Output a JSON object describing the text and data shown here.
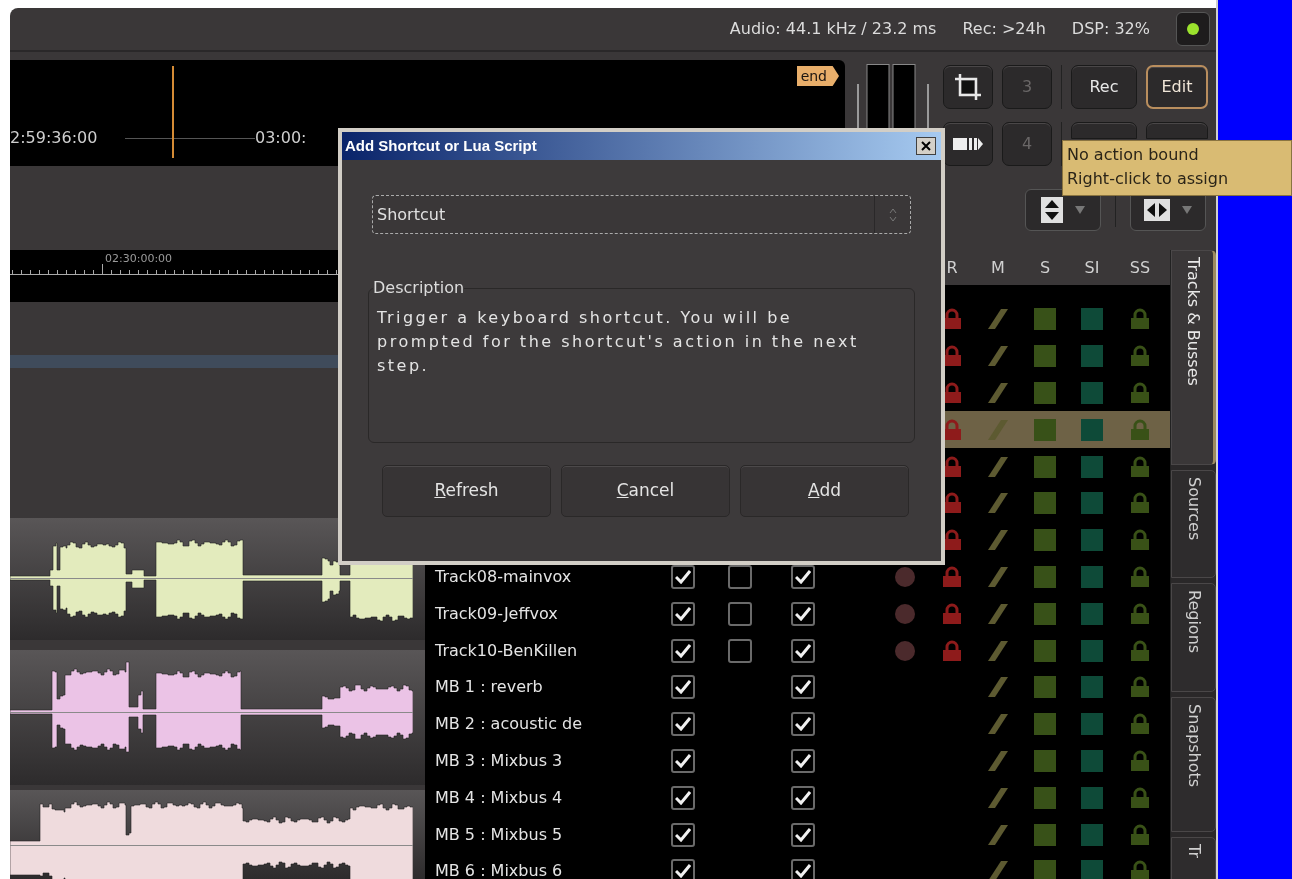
{
  "status_bar": {
    "items": [
      "Audio: 44.1 kHz / 23.2 ms",
      "Rec: >24h",
      "DSP: 32%"
    ],
    "indicator_on": true
  },
  "clock": {
    "timecodes": [
      "2:59:36:00",
      "03:00:"
    ],
    "end_marker": "end"
  },
  "number_buttons": [
    "3",
    "4"
  ],
  "mode_buttons": [
    {
      "label": "Rec",
      "selected": false
    },
    {
      "label": "Edit",
      "selected": true
    }
  ],
  "ruler": {
    "label": "02:30:00:00"
  },
  "regions": [
    {
      "color": "#e3ebbd"
    },
    {
      "color": "#ebc3e6"
    },
    {
      "color": "#efdbdd"
    }
  ],
  "tracks_list": {
    "columns": [
      "R",
      "M",
      "S",
      "SI",
      "SS"
    ],
    "rows": [
      {
        "kind": "track",
        "selected": false
      },
      {
        "kind": "track",
        "selected": false
      },
      {
        "kind": "track",
        "selected": false
      },
      {
        "kind": "track",
        "selected": true
      },
      {
        "kind": "track",
        "selected": false
      },
      {
        "kind": "track",
        "selected": false
      },
      {
        "kind": "track",
        "selected": false
      },
      {
        "kind": "track",
        "selected": false,
        "name": "Track08-mainvox",
        "checks": [
          true,
          false,
          true
        ],
        "rec_dot": true
      },
      {
        "kind": "track",
        "selected": false,
        "name": "Track09-Jeffvox",
        "checks": [
          true,
          false,
          true
        ],
        "rec_dot": true
      },
      {
        "kind": "track",
        "selected": false,
        "name": "Track10-BenKillen",
        "checks": [
          true,
          false,
          true
        ],
        "rec_dot": true
      },
      {
        "kind": "bus",
        "selected": false,
        "name": "MB 1 : reverb",
        "checks": [
          true,
          true
        ]
      },
      {
        "kind": "bus",
        "selected": false,
        "name": "MB 2 : acoustic de",
        "checks": [
          true,
          true
        ]
      },
      {
        "kind": "bus",
        "selected": false,
        "name": "MB 3 : Mixbus 3",
        "checks": [
          true,
          true
        ]
      },
      {
        "kind": "bus",
        "selected": false,
        "name": "MB 4 : Mixbus 4",
        "checks": [
          true,
          true
        ]
      },
      {
        "kind": "bus",
        "selected": false,
        "name": "MB 5 : Mixbus 5",
        "checks": [
          true,
          true
        ]
      },
      {
        "kind": "bus",
        "selected": false,
        "name": "MB 6 : Mixbus 6",
        "checks": [
          true,
          true
        ]
      }
    ]
  },
  "tabs": [
    {
      "label": "Tracks & Busses",
      "selected": true
    },
    {
      "label": "Sources",
      "selected": false
    },
    {
      "label": "Regions",
      "selected": false
    },
    {
      "label": "Snapshots",
      "selected": false
    },
    {
      "label": "Tr",
      "selected": false
    }
  ],
  "dialog": {
    "title": "Add Shortcut or Lua Script",
    "type_select": {
      "value": "Shortcut"
    },
    "description_label": "Description",
    "description": "Trigger a keyboard shortcut. You will be prompted for the shortcut's action in the next step.",
    "buttons": [
      "Refresh",
      "Cancel",
      "Add"
    ]
  },
  "tooltip": {
    "lines": [
      "No action bound",
      "Right-click to assign"
    ]
  }
}
